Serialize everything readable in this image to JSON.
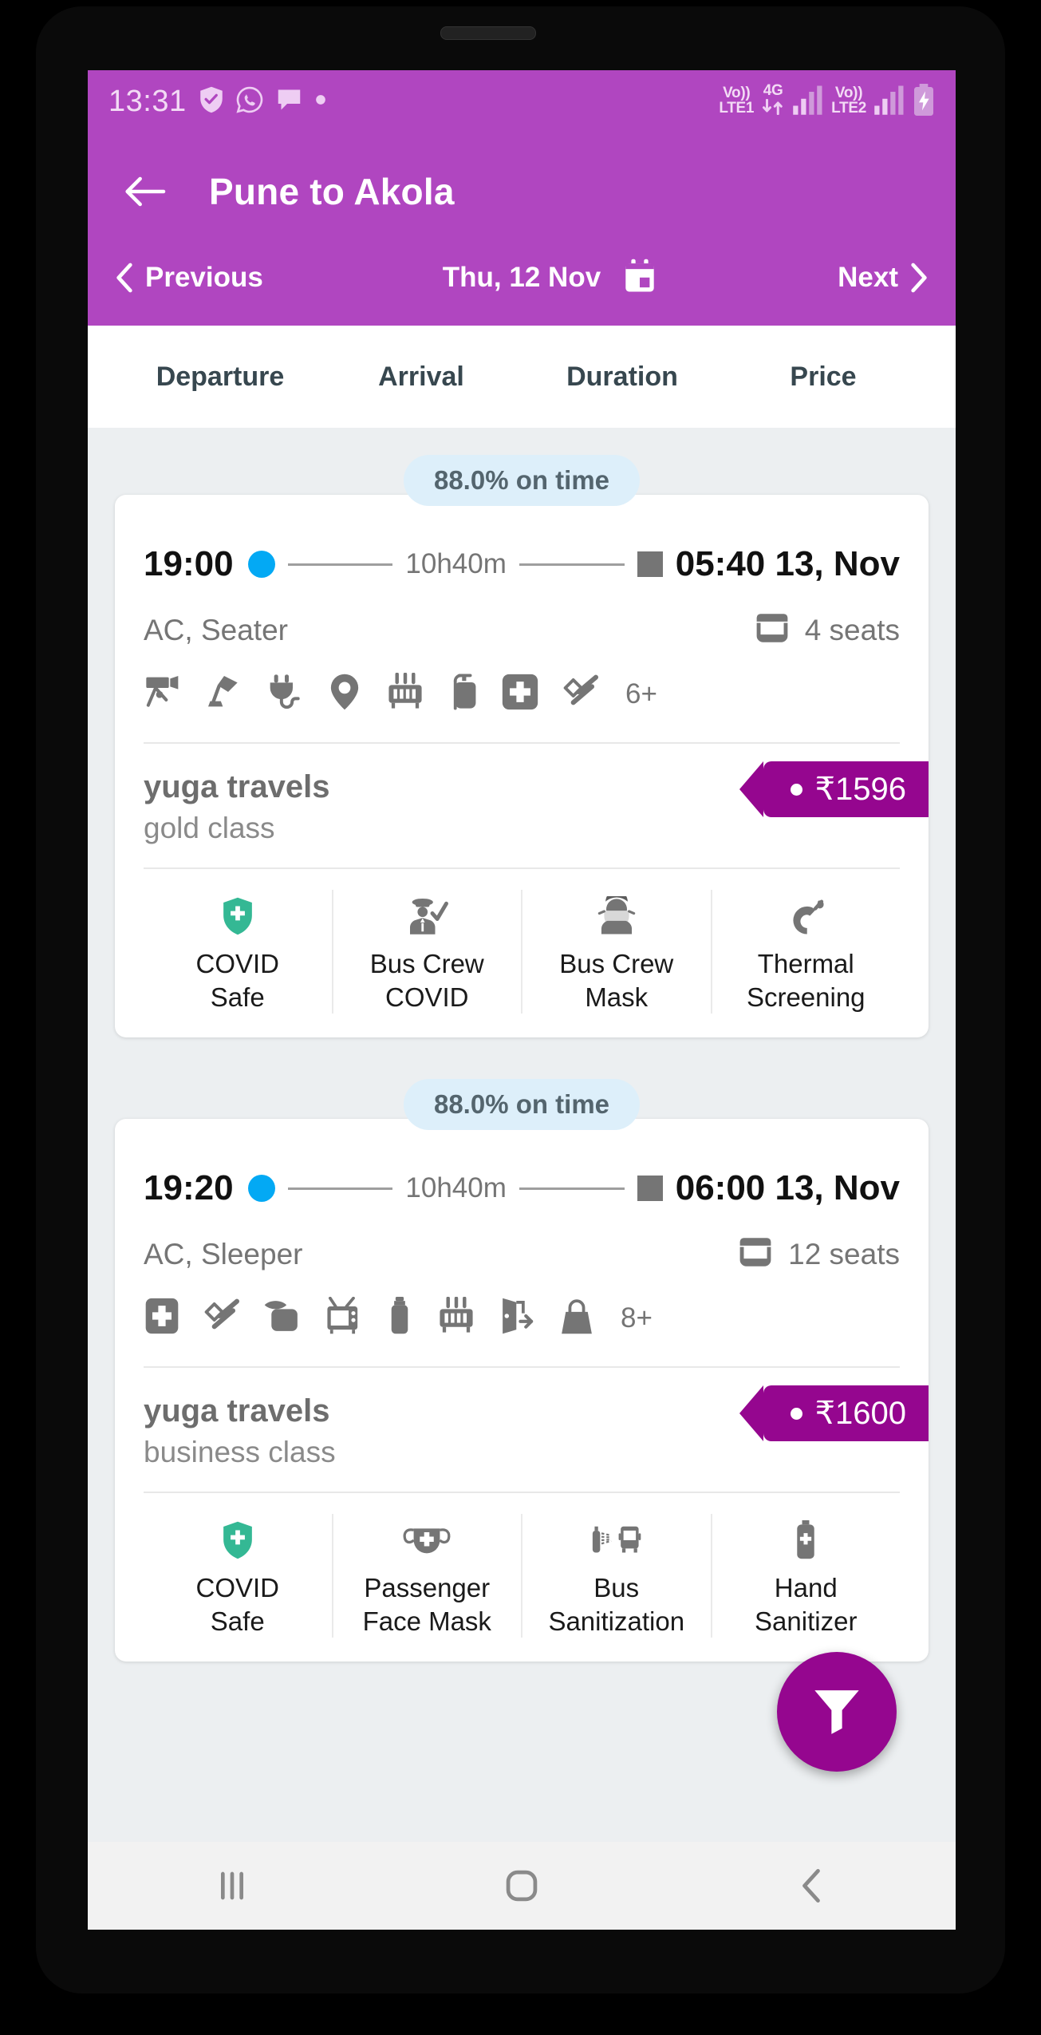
{
  "status_bar": {
    "clock": "13:31",
    "left_icons": [
      "shield-check-icon",
      "whatsapp-icon",
      "message-icon",
      "dot-icon"
    ],
    "sim1_top": "Vo))",
    "sim1_bottom": "LTE1",
    "network_type": "4G",
    "sim2_top": "Vo))",
    "sim2_bottom": "LTE2",
    "right_icons": [
      "data-transfer-icon",
      "signal-bars-icon",
      "signal-bars-icon",
      "battery-charging-icon"
    ]
  },
  "app_bar": {
    "back_icon": "back-arrow-icon",
    "title": "Pune to Akola"
  },
  "date_nav": {
    "previous_label": "Previous",
    "current_date": "Thu, 12 Nov",
    "next_label": "Next",
    "calendar_icon": "calendar-icon"
  },
  "sort_header": {
    "columns": [
      "Departure",
      "Arrival",
      "Duration",
      "Price"
    ]
  },
  "theme": {
    "app_bar_purple": "#b046c0",
    "price_purple": "#95068f",
    "pill_blue_bg": "#ddeffa",
    "dot_blue": "#03a9f4",
    "shield_green": "#34b894"
  },
  "buses": [
    {
      "on_time": "88.0% on time",
      "departure_time": "19:00",
      "duration": "10h40m",
      "arrival_time": "05:40 13, Nov",
      "bus_type": "AC, Seater",
      "seats": "4 seats",
      "seat_icon": "seat-icon",
      "amenities": [
        "cctv-camera-icon",
        "reading-lamp-icon",
        "charging-point-icon",
        "gps-tracking-icon",
        "heater-icon",
        "fire-extinguisher-icon",
        "first-aid-kit-icon",
        "emergency-hammer-icon"
      ],
      "amenities_more": "6+",
      "operator": "yuga travels",
      "bus_class": "gold class",
      "price": "₹1596",
      "covid_badges": [
        {
          "icon": "covid-safe-shield-icon",
          "label": "COVID\nSafe"
        },
        {
          "icon": "bus-crew-covid-icon",
          "label": "Bus Crew\nCOVID"
        },
        {
          "icon": "bus-crew-mask-icon",
          "label": "Bus Crew\nMask"
        },
        {
          "icon": "thermal-screening-icon",
          "label": "Thermal\nScreening"
        }
      ]
    },
    {
      "on_time": "88.0% on time",
      "departure_time": "19:20",
      "duration": "10h40m",
      "arrival_time": "06:00 13, Nov",
      "bus_type": "AC, Sleeper",
      "seats": "12 seats",
      "seat_icon": "seat-icon",
      "amenities": [
        "first-aid-kit-icon",
        "emergency-hammer-icon",
        "pillow-blanket-icon",
        "television-icon",
        "water-bottle-icon",
        "heater-icon",
        "emergency-exit-icon",
        "luggage-bag-icon"
      ],
      "amenities_more": "8+",
      "operator": "yuga travels",
      "bus_class": "business class",
      "price": "₹1600",
      "covid_badges": [
        {
          "icon": "covid-safe-shield-icon",
          "label": "COVID\nSafe"
        },
        {
          "icon": "passenger-face-mask-icon",
          "label": "Passenger\nFace Mask"
        },
        {
          "icon": "bus-sanitization-icon",
          "label": "Bus\nSanitization"
        },
        {
          "icon": "hand-sanitizer-icon",
          "label": "Hand\nSanitizer"
        }
      ]
    }
  ],
  "filter_fab": {
    "icon": "filter-funnel-icon"
  },
  "nav_bar": {
    "recents_icon": "recents-icon",
    "home_icon": "home-icon",
    "back_icon": "nav-back-icon"
  }
}
